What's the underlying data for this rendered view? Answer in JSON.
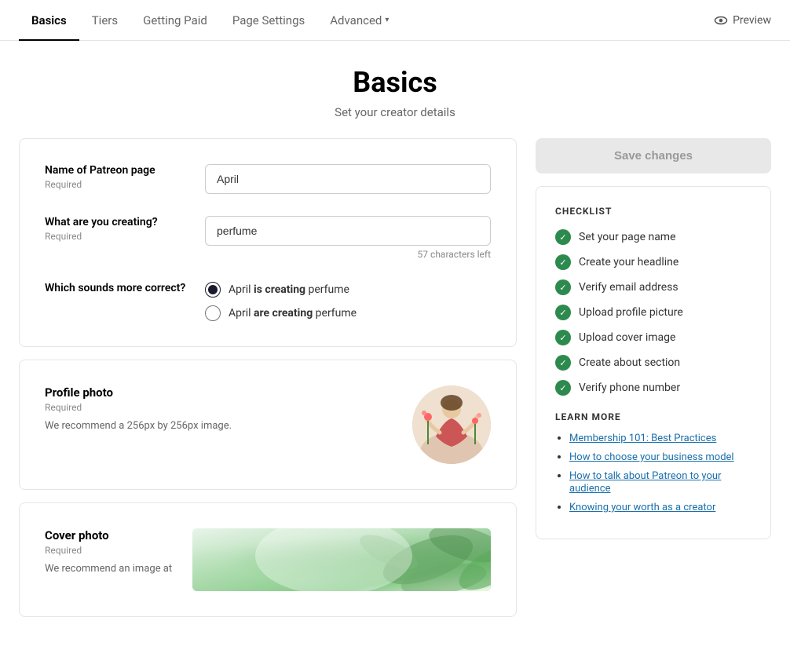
{
  "nav": {
    "items": [
      {
        "label": "Basics",
        "active": true
      },
      {
        "label": "Tiers",
        "active": false
      },
      {
        "label": "Getting Paid",
        "active": false
      },
      {
        "label": "Page Settings",
        "active": false
      },
      {
        "label": "Advanced",
        "active": false,
        "hasChevron": true
      }
    ],
    "preview_label": "Preview"
  },
  "page": {
    "title": "Basics",
    "subtitle": "Set your creator details"
  },
  "form": {
    "name_label": "Name of Patreon page",
    "name_required": "Required",
    "name_value": "April",
    "creating_label": "What are you creating?",
    "creating_required": "Required",
    "creating_value": "perfume",
    "char_count": "57",
    "char_label": "characters left",
    "pronoun_label": "Which sounds more correct?",
    "option1_prefix": "April ",
    "option1_bold": "is creating",
    "option1_suffix": " perfume",
    "option2_prefix": "April ",
    "option2_bold": "are creating",
    "option2_suffix": " perfume"
  },
  "profile_photo": {
    "label": "Profile photo",
    "required": "Required",
    "description": "We recommend a 256px by 256px image."
  },
  "cover_photo": {
    "label": "Cover photo",
    "required": "Required",
    "description": "We recommend an image at"
  },
  "save_button": "Save changes",
  "checklist": {
    "title": "CHECKLIST",
    "items": [
      "Set your page name",
      "Create your headline",
      "Verify email address",
      "Upload profile picture",
      "Upload cover image",
      "Create about section",
      "Verify phone number"
    ]
  },
  "learn_more": {
    "title": "LEARN MORE",
    "links": [
      "Membership 101: Best Practices",
      "How to choose your business model",
      "How to talk about Patreon to your audience",
      "Knowing your worth as a creator"
    ]
  }
}
